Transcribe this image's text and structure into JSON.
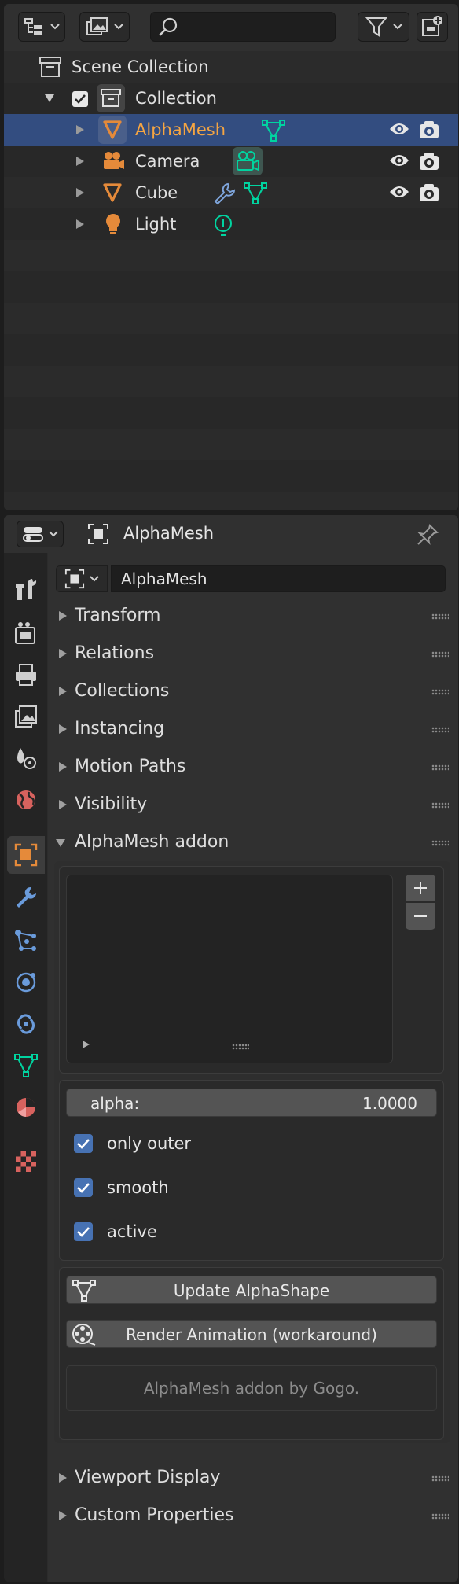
{
  "outliner": {
    "search": {
      "placeholder": ""
    },
    "items": [
      {
        "label": "Scene Collection"
      },
      {
        "label": "Collection"
      },
      {
        "label": "AlphaMesh"
      },
      {
        "label": "Camera"
      },
      {
        "label": "Cube"
      },
      {
        "label": "Light"
      }
    ]
  },
  "properties": {
    "header": {
      "object_name": "AlphaMesh"
    },
    "name_field": {
      "value": "AlphaMesh"
    },
    "panels": [
      {
        "title": "Transform",
        "expanded": false
      },
      {
        "title": "Relations",
        "expanded": false
      },
      {
        "title": "Collections",
        "expanded": false
      },
      {
        "title": "Instancing",
        "expanded": false
      },
      {
        "title": "Motion Paths",
        "expanded": false
      },
      {
        "title": "Visibility",
        "expanded": false
      },
      {
        "title": "AlphaMesh addon",
        "expanded": true
      },
      {
        "title": "Viewport Display",
        "expanded": false
      },
      {
        "title": "Custom Properties",
        "expanded": false
      }
    ],
    "addon": {
      "alpha": {
        "label": "alpha:",
        "value": "1.0000"
      },
      "checkboxes": [
        {
          "label": "only outer",
          "checked": true
        },
        {
          "label": "smooth",
          "checked": true
        },
        {
          "label": "active",
          "checked": true
        }
      ],
      "update_button": "Update AlphaShape",
      "render_button": "Render Animation (workaround)",
      "credit": "AlphaMesh addon by Gogo."
    }
  },
  "colors": {
    "selected_row": "#334d80",
    "selected_text": "#f5a542",
    "checkbox": "#4772b3",
    "mesh_data_icon": "#00d4a0",
    "object_icon": "#e58a3a"
  },
  "icons": {
    "outliner": [
      "outliner-display-mode-icon",
      "view-layer-icon",
      "search-icon",
      "filter-icon",
      "new-collection-icon",
      "collection-icon",
      "checkbox-icon",
      "mesh-object-icon",
      "camera-object-icon",
      "light-object-icon",
      "wrench-modifier-icon",
      "mesh-data-icon",
      "camera-data-icon",
      "light-data-icon",
      "eye-icon",
      "render-camera-icon"
    ],
    "properties_tabs": [
      "tool-icon",
      "render-icon",
      "output-icon",
      "view-layer-icon",
      "scene-icon",
      "world-icon",
      "object-icon",
      "modifier-icon",
      "particles-icon",
      "physics-icon",
      "constraints-icon",
      "data-icon",
      "material-icon",
      "texture-icon"
    ]
  }
}
